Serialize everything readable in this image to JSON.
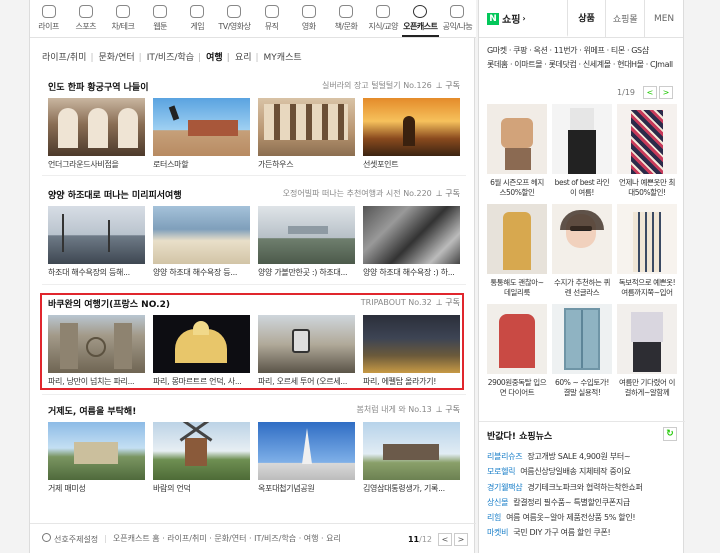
{
  "categories": [
    {
      "label": "라이프",
      "icon": "life-icon"
    },
    {
      "label": "스포츠",
      "icon": "sports-icon"
    },
    {
      "label": "차/테크",
      "icon": "car-icon"
    },
    {
      "label": "웹툰",
      "icon": "webtoon-icon"
    },
    {
      "label": "게임",
      "icon": "game-icon"
    },
    {
      "label": "TV/영화상",
      "icon": "tv-icon"
    },
    {
      "label": "뮤직",
      "icon": "music-icon"
    },
    {
      "label": "영화",
      "icon": "movie-icon"
    },
    {
      "label": "책/문화",
      "icon": "book-icon"
    },
    {
      "label": "지식/교양",
      "icon": "knowledge-icon"
    },
    {
      "label": "오픈캐스트",
      "icon": "opencast-icon",
      "active": true
    },
    {
      "label": "공익/나눔",
      "icon": "share-icon"
    }
  ],
  "subtabs": [
    "라이프/취미",
    "문화/연터",
    "IT/비즈/학습",
    "여행",
    "요리",
    "MY캐스트"
  ],
  "active_subtab": 3,
  "sections": [
    {
      "title": "인도 한파 황궁구역 나들이",
      "meta": "실버라의 장고 털털털기 No.126",
      "subscribe": "구독",
      "items": [
        {
          "caption": "언더그라운드사비접을"
        },
        {
          "caption": "로터스마할"
        },
        {
          "caption": "가든하우스"
        },
        {
          "caption": "선셋포인트"
        }
      ]
    },
    {
      "title": "양양 하조대로 떠나는 미리피서여행",
      "meta": "오정어빌파 떠나는 추천여행과 시전 No.220",
      "subscribe": "구독",
      "items": [
        {
          "caption": "하조대 해수욕장의 등해..."
        },
        {
          "caption": "양양 하조대 해수욕장 등..."
        },
        {
          "caption": "양양 가볼만한곳 :) 하조대..."
        },
        {
          "caption": "양양 하조대 해수욕장 :) 하..."
        }
      ]
    },
    {
      "title": "바쿠완의 여행기(프랑스 NO.2)",
      "meta": "TRIPABOUT No.32",
      "subscribe": "구독",
      "items": [
        {
          "caption": "파리, 낭만이 넘치는 파리..."
        },
        {
          "caption": "파리, 몽마르트르 언덕, 사..."
        },
        {
          "caption": "파리, 오르세 투어 (오르세..."
        },
        {
          "caption": "파리, 에펠탑 올라가기!"
        }
      ]
    },
    {
      "title": "거제도, 여름을 부탁해!",
      "meta": "봄처럼 내게 와 No.13",
      "subscribe": "구독",
      "items": [
        {
          "caption": "거제 매미성"
        },
        {
          "caption": "바람의 언덕"
        },
        {
          "caption": "옥포대첩기념공원"
        },
        {
          "caption": "김영삼대통령생가, 기록..."
        }
      ]
    }
  ],
  "footer": {
    "settings_label": "선호주제설정",
    "path": "오픈캐스트 홈 · 라이프/취미 · 문화/연터 · IT/비즈/학습 · 여행 · 요리",
    "page": "11",
    "total": "12"
  },
  "shopping": {
    "logo_letter": "N",
    "title": "쇼핑",
    "tabs": [
      "상품",
      "쇼핑몰",
      "MEN"
    ],
    "brands_line1": "G마켓 · 쿠팡 · 옥션 · 11번가 · 위메프 · 티몬 · GS샵",
    "brands_line2": "롯데홈 · 이마트몰 · 롯데닷컴 · 신세계몰 · 현대H몰 · CJmall",
    "page": "1",
    "total": "19",
    "products": [
      {
        "title": "6월 시즌오프 헤지스50%할인"
      },
      {
        "title": "best of best 라인이 여름!"
      },
      {
        "title": "언제나 예쁜옷만 최대50%할인!"
      },
      {
        "title": "통통해도 괜찮아~ 데일리룩"
      },
      {
        "title": "수지가 추천하는 퀴렌 선글라스"
      },
      {
        "title": "독보적으로 예쁜옷! 여름까지쭉~입어"
      },
      {
        "title": "2900원중독탈 입으면 다이어트"
      },
      {
        "title": "60% ~ 수입토가! 결말 실용적!"
      },
      {
        "title": "여름만 기다렸어 이걸하게~알함께"
      }
    ],
    "news_title": "반값다! 쇼핑뉴스",
    "news": [
      {
        "src": "리블리슈즈",
        "text": "장고개방 SALE 4,900원 부터~"
      },
      {
        "src": "모로헬릭",
        "text": "여름신상당일배송 지체테작 중이요"
      },
      {
        "src": "경기웰팩샵",
        "text": "경기테크노파크와 협력하는착한쇼퍼"
      },
      {
        "src": "상신몰",
        "text": "칼결정리 필수품~ 특별할인쿠폰지급"
      },
      {
        "src": "리힘",
        "text": "여름 여름옷~알아 제품전상품 5% 할인!"
      },
      {
        "src": "마켓비",
        "text": "국민 DIY 가구 여름 할인 쿠폰!"
      }
    ]
  },
  "colors": {
    "highlight": "#e0262d",
    "naver_green": "#03c75a",
    "link_blue": "#1a7fc9"
  }
}
